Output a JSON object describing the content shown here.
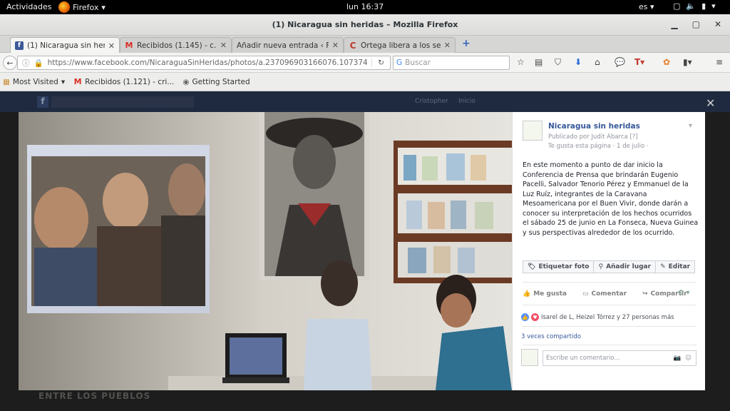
{
  "topbar": {
    "activities": "Actividades",
    "app": "Firefox",
    "clock": "lun 16:37",
    "lang": "es"
  },
  "window": {
    "title": "(1) Nicaragua sin heridas – Mozilla Firefox"
  },
  "tabs": [
    {
      "label": "(1) Nicaragua sin heri...",
      "favicon": "facebook-icon",
      "active": true
    },
    {
      "label": "Recibidos (1.145) - c...",
      "favicon": "gmail-icon",
      "active": false
    },
    {
      "label": "Añadir nueva entrada ‹ F...",
      "favicon": "wordpress-icon",
      "active": false
    },
    {
      "label": "Ortega libera a los sei...",
      "favicon": "c-icon",
      "active": false
    }
  ],
  "nav": {
    "url": "https://www.facebook.com/NicaraguaSinHeridas/photos/a.237096903166076.1073741",
    "search_placeholder": "Buscar"
  },
  "bookmarks": [
    {
      "label": "Most Visited",
      "icon": "bookmarks-folder-icon"
    },
    {
      "label": "Recibidos (1.121) - cri...",
      "icon": "gmail-icon"
    },
    {
      "label": "Getting Started",
      "icon": "globe-icon"
    }
  ],
  "fb": {
    "user_name": "Cristopher",
    "home": "Inicio"
  },
  "post": {
    "page_name": "Nicaragua sin heridas",
    "published_by": "Publicado por Judit Abarca [?]",
    "meta": "Te gusta esta página · 1 de julio ·",
    "text": "En este momento a punto de dar inicio la Conferencia de Prensa que brindarán Eugenio Pacelli, Salvador Tenorio Pérez y Emmanuel de la Luz Ruíz, integrantes de la Caravana Mesoamericana por el Buen Vivir, donde darán a conocer su interpretación de los hechos ocurridos el sábado 25 de junio en La Fonseca, Nueva Guinea y sus perspectivas alrededor de los ocurrido.",
    "tag_photo": "Etiquetar foto",
    "add_location": "Añadir lugar",
    "edit": "Editar",
    "like": "Me gusta",
    "comment": "Comentar",
    "share": "Compartir",
    "likes_summary": "Isarel de L, Heizel Tórrez y 27 personas más",
    "shared_count": "3 veces compartido",
    "comment_placeholder": "Escribe un comentario..."
  },
  "background_text": "ENTRE LOS PUEBLOS"
}
